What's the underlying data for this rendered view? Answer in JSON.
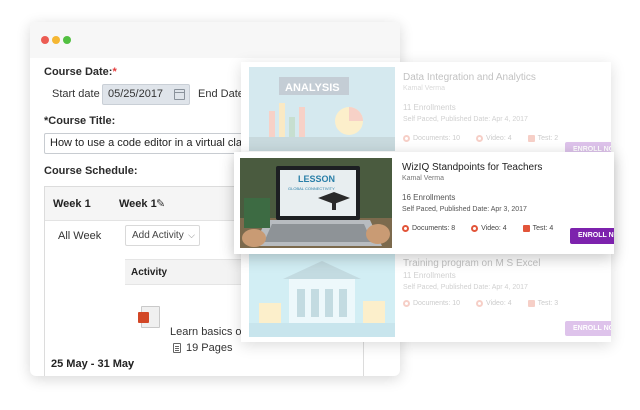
{
  "form": {
    "course_date_label": "Course Date:",
    "required_mark": "*",
    "start_date_label": "Start date",
    "start_date_value": "05/25/2017",
    "end_date_label": "End Date",
    "course_title_label": "*Course Title:",
    "course_title_value": "How to use a code editor in a virtual classro",
    "course_schedule_label": "Course Schedule:",
    "week_col_label": "Week 1",
    "week_name": "Week 1",
    "all_week_label": "All Week",
    "add_activity_label": "Add Activity",
    "activity_header": "Activity",
    "activity_item_title": "Learn basics of c",
    "activity_pages": "19 Pages",
    "date_range": "25 May - 31 May"
  },
  "catalog": [
    {
      "title": "Data Integration and Analytics",
      "author": "Kamal Verma",
      "enrollments": "11 Enrollments",
      "published": "Self Paced, Published Date: Apr 4, 2017",
      "documents": "Documents: 10",
      "video": "Video: 4",
      "test": "Test: 2",
      "thumb_text": "ANALYSIS",
      "enroll_label": "ENROLL NOW"
    },
    {
      "title": "WizIQ Standpoints for Teachers",
      "author": "Kamal Verma",
      "enrollments": "16 Enrollments",
      "published": "Self Paced, Published Date: Apr 3, 2017",
      "documents": "Documents: 8",
      "video": "Video: 4",
      "test": "Test: 4",
      "thumb_text": "LESSON",
      "thumb_sub": "GLOBAL CONNECTIVITY",
      "enroll_label": "ENROLL NOW"
    },
    {
      "title": "Training program on M S Excel",
      "author": "",
      "enrollments": "11 Enrollments",
      "published": "Self Paced, Published Date: Apr 4, 2017",
      "documents": "Documents: 10",
      "video": "Video: 4",
      "test": "Test: 3",
      "enroll_label": "ENROLL NOW"
    }
  ],
  "colors": {
    "enroll": "#8a2db8",
    "required": "#e43b3b",
    "stat_icon": "#e2553a"
  }
}
